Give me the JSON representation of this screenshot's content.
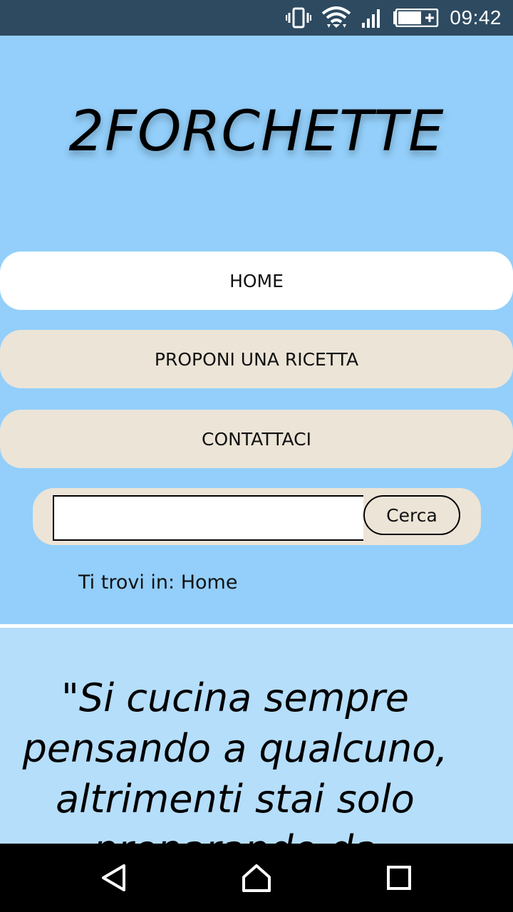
{
  "status_bar": {
    "time": "09:42",
    "icons": [
      "vibrate-icon",
      "wifi-icon",
      "signal-icon",
      "battery-charging-icon"
    ]
  },
  "site": {
    "title": "2FORCHETTE"
  },
  "nav": {
    "items": [
      {
        "label": "HOME",
        "active": true
      },
      {
        "label": "PROPONI UNA RICETTA",
        "active": false
      },
      {
        "label": "CONTATTACI",
        "active": false
      }
    ]
  },
  "search": {
    "value": "",
    "button_label": "Cerca"
  },
  "breadcrumb": "Ti trovi in: Home",
  "quote": {
    "lines": [
      "\"Si cucina sempre",
      "pensando a qualcuno,",
      "altrimenti stai solo",
      "preparando da"
    ]
  },
  "system_nav": {
    "icons": [
      "back-icon",
      "home-icon",
      "recents-icon"
    ]
  },
  "colors": {
    "background": "#93cffa",
    "status_bar": "#2d4a60",
    "nav_active": "#ffffff",
    "nav_inactive": "#ece4d7",
    "content_bg": "#b5defb"
  }
}
